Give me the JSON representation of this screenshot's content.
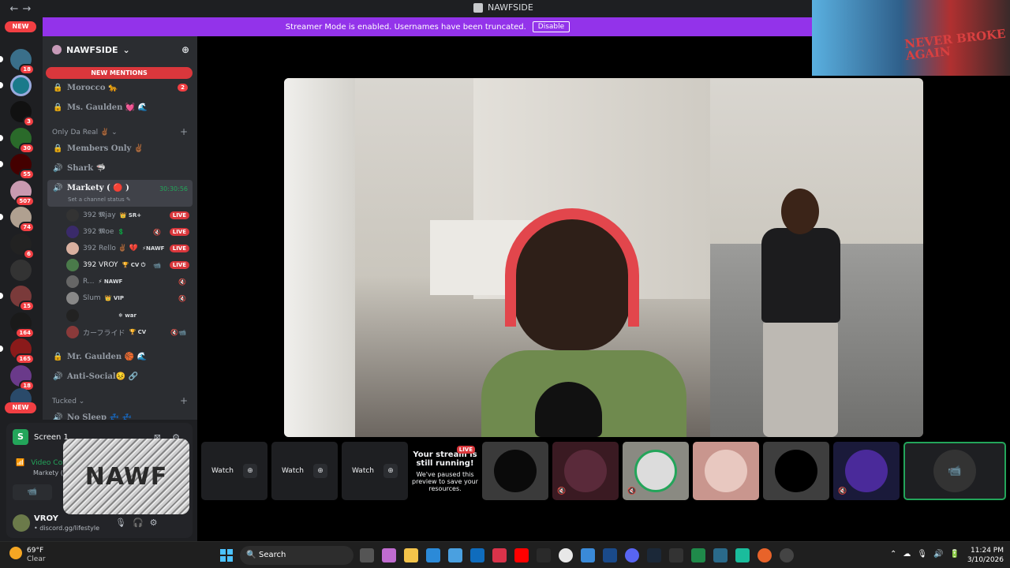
{
  "window": {
    "title": "NAWFSIDE",
    "back_glyph": "←",
    "forward_glyph": "→"
  },
  "banner": {
    "message": "Streamer Mode is enabled. Usernames have been truncated.",
    "button": "Disable"
  },
  "guild_rail": {
    "top_pill": "NEW",
    "bottom_pill": "NEW",
    "badges": [
      "18",
      "3",
      "30",
      "55",
      "507",
      "74",
      "6",
      "15",
      "164",
      "165",
      "18"
    ]
  },
  "server": {
    "name": "NAWFSIDE",
    "chevron": "⌄",
    "new_mentions": "NEW MENTIONS",
    "channels_top": [
      {
        "name": "Morocco 🐆",
        "count": "2",
        "icon": "lock-icon"
      },
      {
        "name": "Ms. Gaulden 💓 🌊",
        "icon": "lock-icon"
      }
    ],
    "category1": "Only Da Real ✌🏾 ⌄",
    "channels_mid": [
      {
        "name": "Members Only ✌🏾",
        "icon": "lock-icon"
      },
      {
        "name": "Shark 🦈",
        "icon": "speaker-icon"
      }
    ],
    "active_channel": {
      "name": "Markety ( 🔴 )",
      "time": "30:30:56",
      "status": "Set a channel status ✎"
    },
    "voice_users": [
      {
        "name": "392 𝕸jay",
        "tag": "👑 SR+",
        "live": "LIVE"
      },
      {
        "name": "392 𝕸oe",
        "tag": "💲",
        "live": "LIVE"
      },
      {
        "name": "392 Rello ✌🏾 💔",
        "tag": "⚡NAWF",
        "live": "LIVE"
      },
      {
        "name": "392 VROY",
        "tag": "🏆 CV ⏻",
        "live": "LIVE"
      },
      {
        "name": "R...",
        "tag": "⚡ NAWF",
        "live": ""
      },
      {
        "name": "Slum",
        "tag": "👑 VIP",
        "live": ""
      },
      {
        "name": "",
        "tag": "❄ war",
        "live": ""
      },
      {
        "name": "カーフライド",
        "tag": "🏆 CV",
        "live": ""
      }
    ],
    "channels_bottom": [
      {
        "name": "Mr. Gaulden 🏀 🌊",
        "icon": "lock-icon"
      },
      {
        "name": "Anti-Social😣 🔗",
        "icon": "speaker-icon"
      }
    ],
    "category2": "Tucked ⌄",
    "channel_last": "No Sleep 💤 💤"
  },
  "user_panel": {
    "screen_label": "Screen 1",
    "voice_connected": "Video Conne...",
    "voice_sub": "Markety (...",
    "username": "VROY",
    "user_status": "• discord.gg/lifestyle",
    "logo_text": "NAWF"
  },
  "pip": {
    "text": "NEVER BROKE AGAIN"
  },
  "tiles": {
    "watch_label": "Watch",
    "paused_title": "Your stream is still running!",
    "paused_body": "We've paused this preview to save your resources.",
    "paused_live": "LIVE"
  },
  "taskbar": {
    "temp": "69°F",
    "condition": "Clear",
    "search": "Search",
    "time": "11:24 PM",
    "date": "3/10/2026"
  },
  "colors": {
    "banner": "#9333ea",
    "live": "#da373c",
    "online": "#23a55a"
  }
}
